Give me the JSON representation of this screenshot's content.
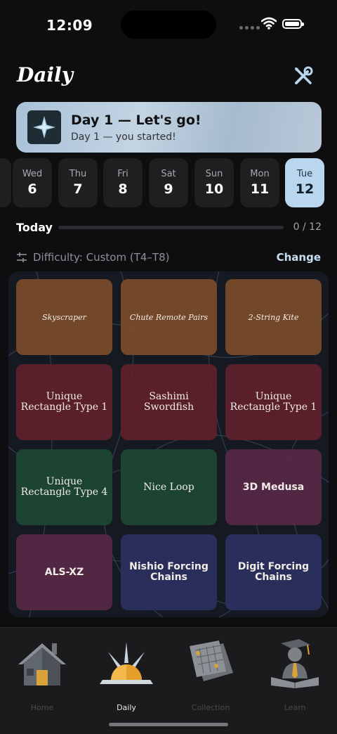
{
  "status_bar": {
    "time": "12:09"
  },
  "header": {
    "title": "Daily",
    "tools_icon": "wrench-screwdriver-icon"
  },
  "banner": {
    "title": "Day 1 — Let's go!",
    "subtitle": "Day 1 — you started!",
    "icon": "four-point-star-icon"
  },
  "week": [
    {
      "name": "Wed",
      "date": "6"
    },
    {
      "name": "Thu",
      "date": "7"
    },
    {
      "name": "Fri",
      "date": "8"
    },
    {
      "name": "Sat",
      "date": "9"
    },
    {
      "name": "Sun",
      "date": "10"
    },
    {
      "name": "Mon",
      "date": "11"
    },
    {
      "name": "Tue",
      "date": "12",
      "selected": true
    }
  ],
  "progress": {
    "label": "Today",
    "count_text": "0 / 12",
    "completed": 0,
    "total": 12
  },
  "difficulty": {
    "label": "Difficulty: Custom (T4–T8)",
    "icon": "sliders-icon",
    "change_label": "Change"
  },
  "puzzles": [
    {
      "name": "Skyscraper",
      "color": "brown",
      "font": "script"
    },
    {
      "name": "Chute Remote Pairs",
      "color": "brown",
      "font": "script"
    },
    {
      "name": "2-String Kite",
      "color": "brown",
      "font": "script"
    },
    {
      "name": "Unique Rectangle Type 1",
      "color": "maroon",
      "font": "serif"
    },
    {
      "name": "Sashimi Swordfish",
      "color": "maroon",
      "font": "serif"
    },
    {
      "name": "Unique Rectangle Type 1",
      "color": "maroon",
      "font": "serif"
    },
    {
      "name": "Unique Rectangle Type 4",
      "color": "green",
      "font": "serif"
    },
    {
      "name": "Nice Loop",
      "color": "green",
      "font": "serif"
    },
    {
      "name": "3D Medusa",
      "color": "plum",
      "font": "sans"
    },
    {
      "name": "ALS-XZ",
      "color": "plum",
      "font": "sans"
    },
    {
      "name": "Nishio Forcing Chains",
      "color": "navy",
      "font": "sans"
    },
    {
      "name": "Digit Forcing Chains",
      "color": "navy",
      "font": "sans"
    }
  ],
  "tabs": [
    {
      "label": "Home",
      "icon": "house-icon",
      "active": false
    },
    {
      "label": "Daily",
      "icon": "sunrise-icon",
      "active": true
    },
    {
      "label": "Collection",
      "icon": "puzzle-sheets-icon",
      "active": false
    },
    {
      "label": "Learn",
      "icon": "graduate-book-icon",
      "active": false
    }
  ],
  "colors": {
    "accent": "#b9d6ee",
    "background": "#0e0e10"
  }
}
